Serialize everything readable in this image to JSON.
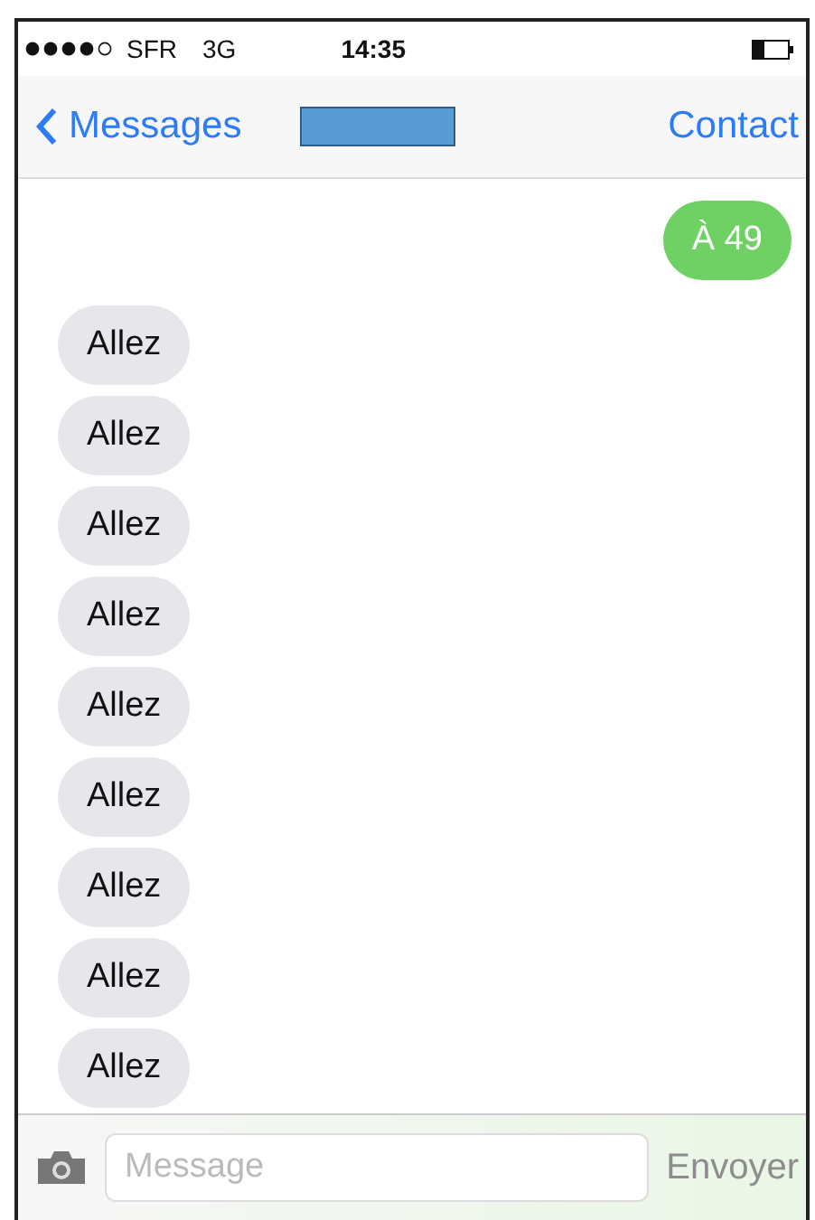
{
  "status_bar": {
    "carrier": "SFR",
    "network": "3G",
    "time": "14:35"
  },
  "nav": {
    "back": "Messages",
    "action": "Contact"
  },
  "messages": [
    {
      "kind": "sent",
      "text": "À 49"
    },
    {
      "kind": "received",
      "text": "Allez"
    },
    {
      "kind": "received",
      "text": "Allez"
    },
    {
      "kind": "received",
      "text": "Allez"
    },
    {
      "kind": "received",
      "text": "Allez"
    },
    {
      "kind": "received",
      "text": "Allez"
    },
    {
      "kind": "received",
      "text": "Allez"
    },
    {
      "kind": "received",
      "text": "Allez"
    },
    {
      "kind": "received",
      "text": "Allez"
    },
    {
      "kind": "received",
      "text": "Allez"
    }
  ],
  "composer": {
    "placeholder": "Message",
    "send": "Envoyer",
    "send_disabled": true
  }
}
